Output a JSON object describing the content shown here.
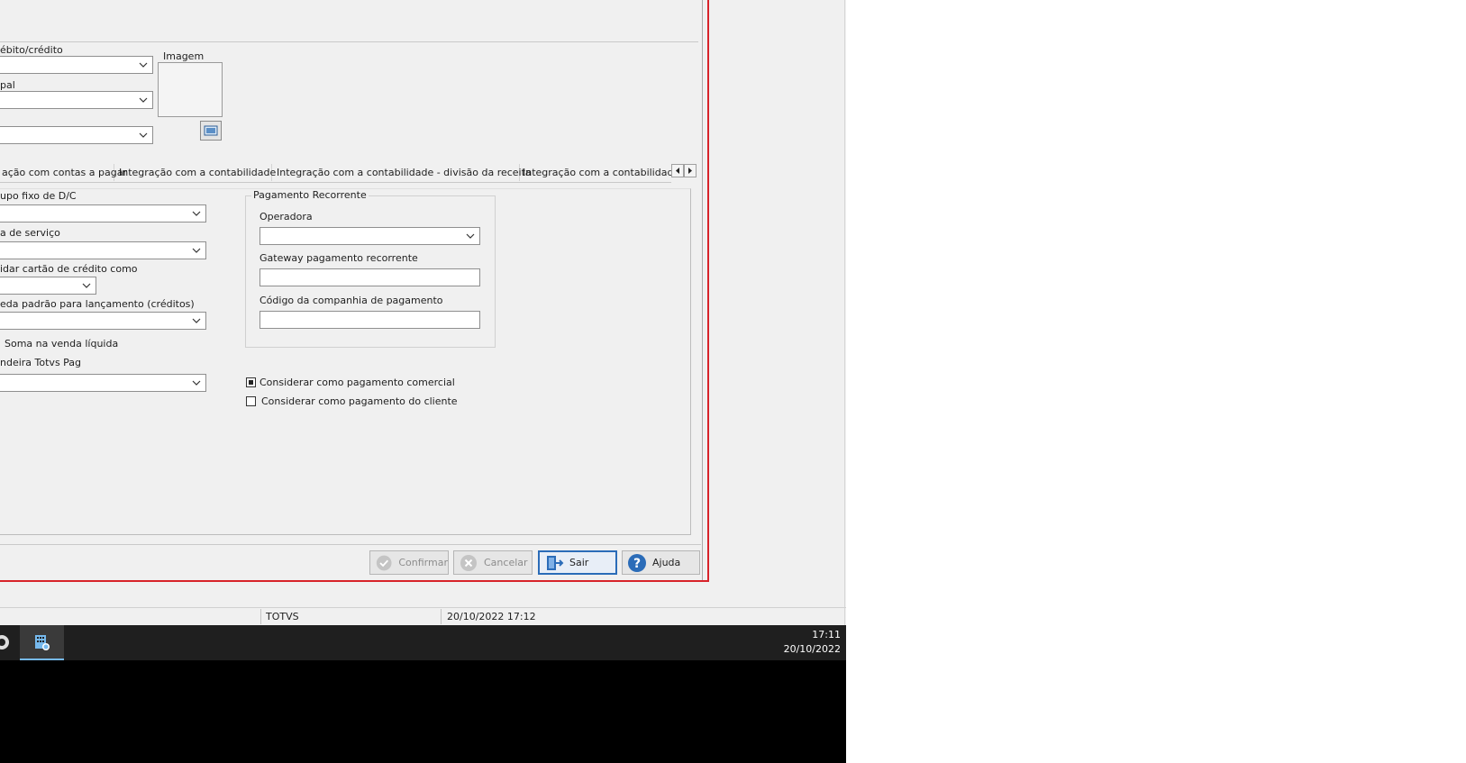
{
  "dialog": {
    "labels": {
      "debito_credito": "ébito/crédito",
      "pal": "pal",
      "imagem": "Imagem"
    },
    "tabs": [
      "ação com contas a pagar",
      "Integração com a contabilidade",
      "Integração com a contabilidade - divisão da receita",
      "Integração com a contabilidade"
    ],
    "left_fields": {
      "grupo_fixo": "upo fixo de D/C",
      "tipo_servico": "a de serviço",
      "cartao_credito": "idar cartão de crédito como",
      "moeda_padrao": "eda padrão para lançamento (créditos)",
      "soma_venda": "Soma na venda líquida",
      "bandeira": "ndeira Totvs Pag"
    },
    "pagamento_recorrente": {
      "title": "Pagamento Recorrente",
      "operadora_label": "Operadora",
      "operadora_value": "",
      "gateway_label": "Gateway pagamento recorrente",
      "gateway_value": "",
      "codigo_label": "Código da companhia de pagamento",
      "codigo_value": ""
    },
    "checkboxes": {
      "comercial": {
        "label": "Considerar como pagamento comercial",
        "checked": true
      },
      "cliente": {
        "label": "Considerar como pagamento do cliente",
        "checked": false
      }
    },
    "buttons": {
      "confirmar": "Confirmar",
      "cancelar": "Cancelar",
      "sair": "Sair",
      "ajuda": "Ajuda"
    }
  },
  "statusbar": {
    "company": "TOTVS",
    "datetime": "20/10/2022 17:12"
  },
  "taskbar": {
    "time": "17:11",
    "date": "20/10/2022"
  },
  "colors": {
    "dialog_border": "#d8232a",
    "accent_blue": "#2b6cb8",
    "taskbar": "#1f1f1f"
  }
}
